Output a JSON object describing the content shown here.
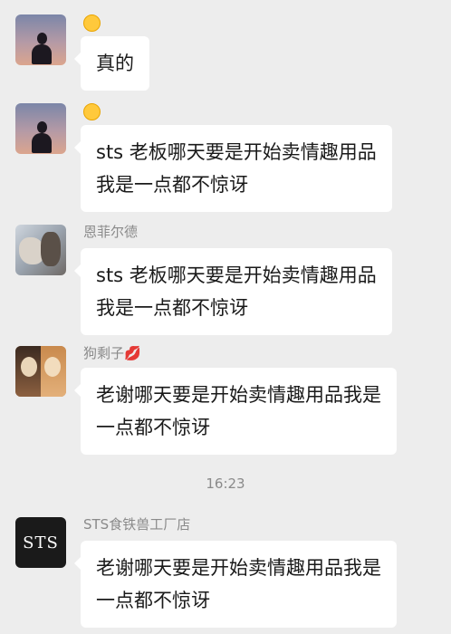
{
  "messages": [
    {
      "sender": "",
      "sender_emoji": "smiling-face",
      "lines": [
        "真的"
      ]
    },
    {
      "sender": "",
      "sender_emoji": "smiling-face",
      "lines": [
        "sts 老板哪天要是开始卖情趣用品",
        "我是一点都不惊讶"
      ]
    },
    {
      "sender": "恩菲尔德",
      "lines": [
        "sts 老板哪天要是开始卖情趣用品",
        "我是一点都不惊讶"
      ]
    },
    {
      "sender": "狗剩子💋",
      "lines": [
        "老谢哪天要是开始卖情趣用品我是",
        "一点都不惊讶"
      ]
    },
    {
      "sender": "STS食铁兽工厂店",
      "avatar_text": "STS",
      "lines": [
        "老谢哪天要是开始卖情趣用品我是",
        "一点都不惊讶"
      ]
    }
  ],
  "timestamp": "16:23",
  "colors": {
    "background": "#ededed",
    "bubble": "#ffffff",
    "meta_text": "#8a8a8a"
  }
}
